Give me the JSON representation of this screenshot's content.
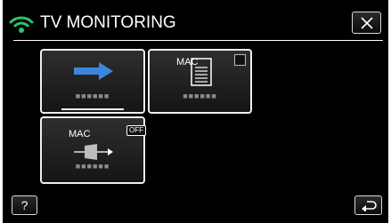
{
  "header": {
    "title": "TV MONITORING",
    "wifi_icon": "wifi-icon",
    "close_icon": "close-icon",
    "accent": "#2cc36b"
  },
  "tiles": [
    {
      "icon": "arrow-right-icon",
      "caption": "■■■■■■",
      "arrow_color": "#3a86d8"
    },
    {
      "icon": "document-icon",
      "mac_label": "MAC",
      "caption": "■■■■■■",
      "checkbox": "unchecked"
    },
    {
      "icon": "arrow-device-icon",
      "mac_label": "MAC",
      "status_badge": "OFF",
      "caption": "■■■■■■"
    }
  ],
  "footer": {
    "help_label": "?",
    "back_icon": "back-icon"
  }
}
